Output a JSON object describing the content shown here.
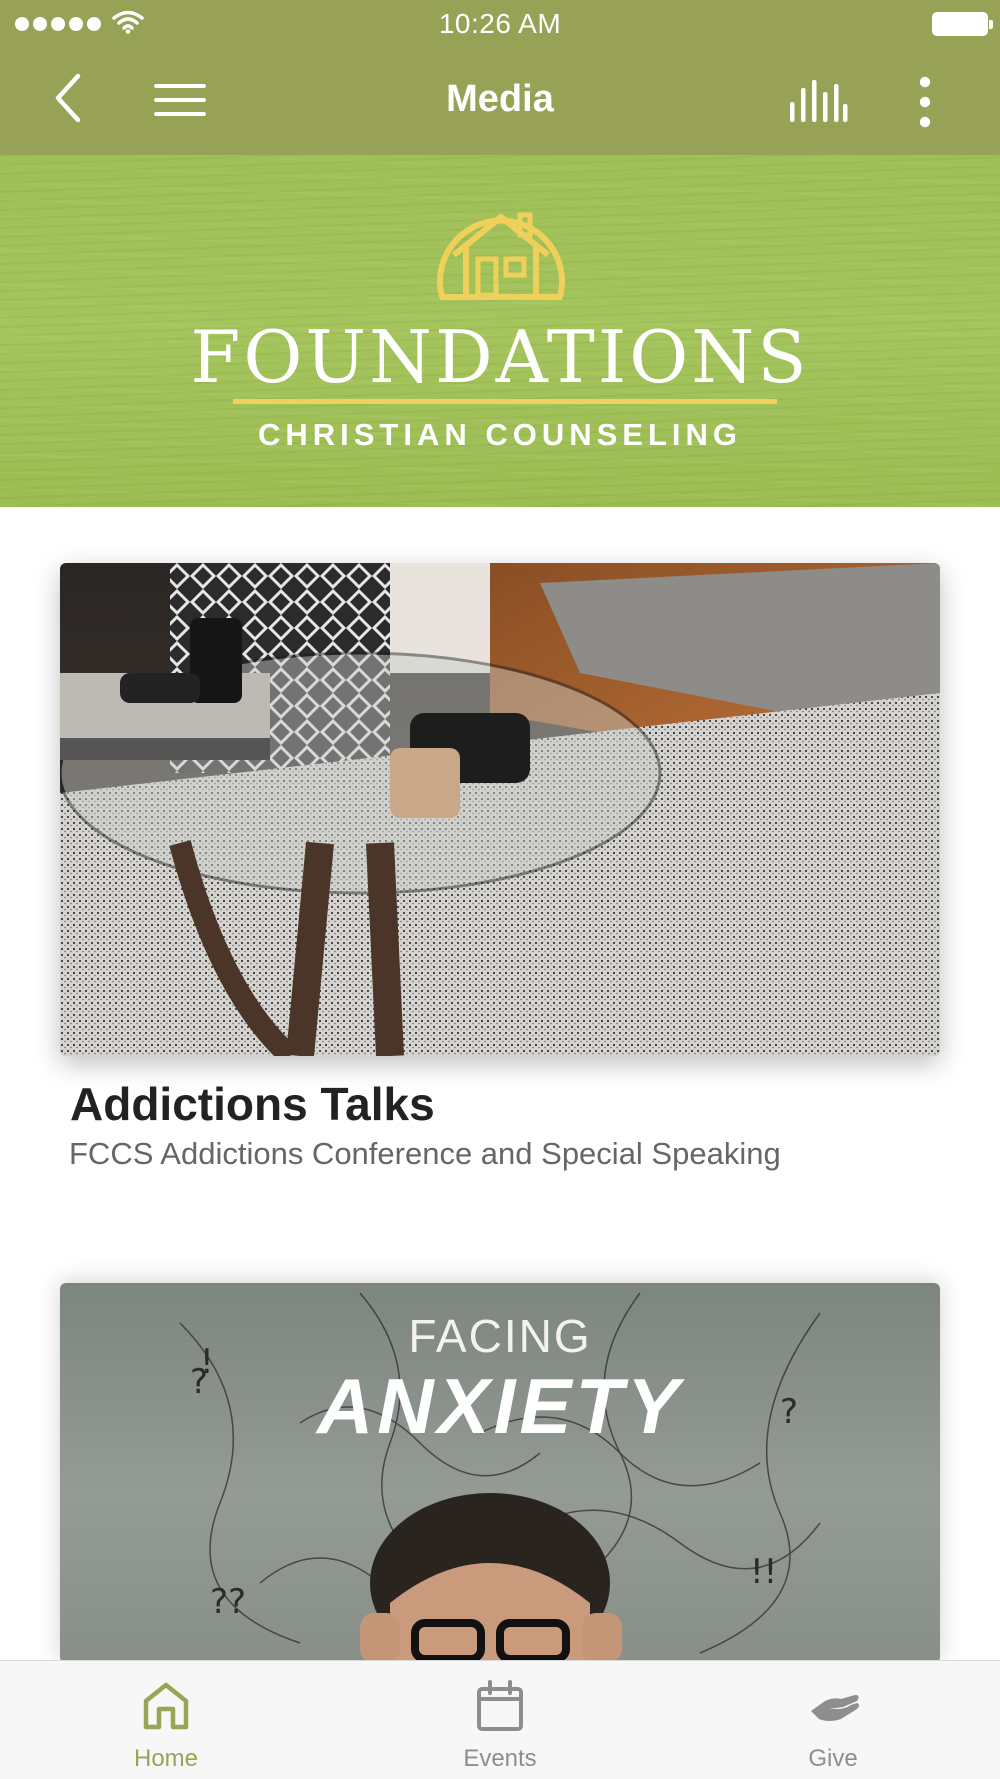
{
  "status_bar": {
    "time": "10:26 AM"
  },
  "nav": {
    "title": "Media"
  },
  "banner": {
    "brand_title": "FOUNDATIONS",
    "brand_subtitle": "CHRISTIAN COUNSELING"
  },
  "cards": [
    {
      "title": "Addictions Talks",
      "subtitle": "FCCS Addictions Conference and Special Speaking"
    },
    {
      "image_text_top": "FACING",
      "image_text_main": "ANXIETY"
    }
  ],
  "tabs": [
    {
      "label": "Home",
      "icon": "home-icon",
      "active": true
    },
    {
      "label": "Events",
      "icon": "calendar-icon",
      "active": false
    },
    {
      "label": "Give",
      "icon": "give-hand-icon",
      "active": false
    }
  ],
  "colors": {
    "header": "#98a257",
    "banner": "#a2c25a",
    "accent_gold": "#f0d15d",
    "tab_active": "#9aa455",
    "tab_inactive": "#8e8e8e"
  }
}
